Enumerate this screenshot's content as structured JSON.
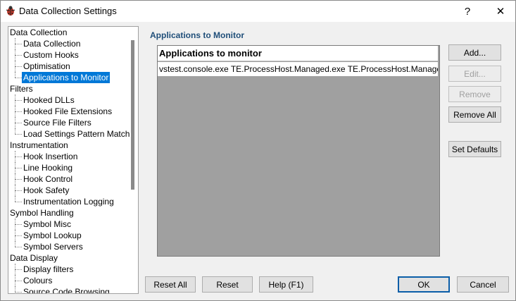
{
  "window": {
    "title": "Data Collection Settings",
    "help": "?",
    "close": "✕"
  },
  "tree": [
    {
      "label": "Data Collection",
      "level": 0
    },
    {
      "label": "Data Collection",
      "level": 1
    },
    {
      "label": "Custom Hooks",
      "level": 1
    },
    {
      "label": "Optimisation",
      "level": 1
    },
    {
      "label": "Applications to Monitor",
      "level": 1,
      "selected": true
    },
    {
      "label": "Filters",
      "level": 0
    },
    {
      "label": "Hooked DLLs",
      "level": 1
    },
    {
      "label": "Hooked File Extensions",
      "level": 1
    },
    {
      "label": "Source File Filters",
      "level": 1
    },
    {
      "label": "Load Settings Pattern Match",
      "level": 1
    },
    {
      "label": "Instrumentation",
      "level": 0
    },
    {
      "label": "Hook Insertion",
      "level": 1
    },
    {
      "label": "Line Hooking",
      "level": 1
    },
    {
      "label": "Hook Control",
      "level": 1
    },
    {
      "label": "Hook Safety",
      "level": 1
    },
    {
      "label": "Instrumentation Logging",
      "level": 1
    },
    {
      "label": "Symbol Handling",
      "level": 0
    },
    {
      "label": "Symbol Misc",
      "level": 1
    },
    {
      "label": "Symbol Lookup",
      "level": 1
    },
    {
      "label": "Symbol Servers",
      "level": 1
    },
    {
      "label": "Data Display",
      "level": 0
    },
    {
      "label": "Display filters",
      "level": 1
    },
    {
      "label": "Colours",
      "level": 1
    },
    {
      "label": "Source Code Browsing",
      "level": 1
    }
  ],
  "panel": {
    "title": "Applications to Monitor",
    "list_header": "Applications to monitor",
    "items": [
      "vstest.console.exe TE.ProcessHost.Managed.exe TE.ProcessHost.Manage..."
    ]
  },
  "buttons": {
    "add": "Add...",
    "edit": "Edit...",
    "remove": "Remove",
    "remove_all": "Remove All",
    "set_defaults": "Set Defaults",
    "reset_all": "Reset All",
    "reset": "Reset",
    "help": "Help (F1)",
    "ok": "OK",
    "cancel": "Cancel"
  },
  "colors": {
    "selection": "#0078d7",
    "panel_title": "#1f4e79",
    "list_bg": "#a0a0a0"
  }
}
